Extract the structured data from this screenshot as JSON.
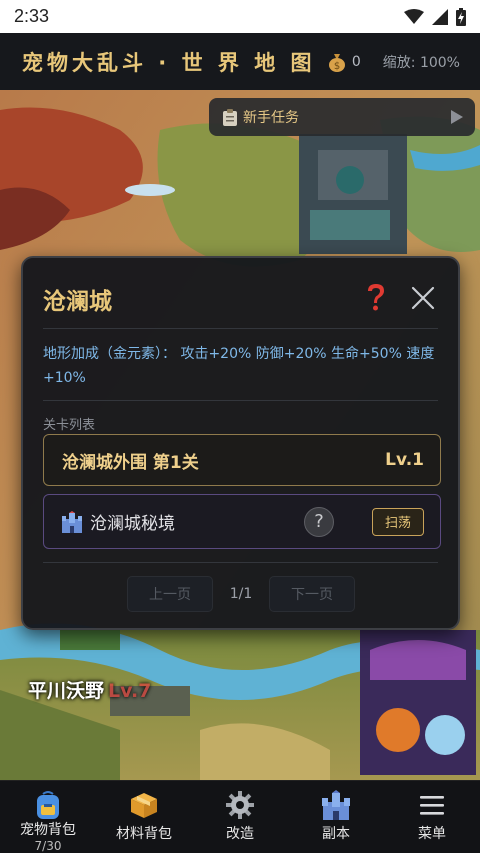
{
  "status_bar": {
    "time": "2:33",
    "icons": [
      "wifi-icon",
      "signal-icon",
      "battery-charging-icon"
    ]
  },
  "header": {
    "title": "宠物大乱斗 · 世 界 地 图",
    "gold_icon": "money-bag-icon",
    "gold_value": "0",
    "zoom_text": "缩放: 100%"
  },
  "quest_bar": {
    "icon": "clipboard-icon",
    "label": "新手任务",
    "arrow_icon": "play-triangle-icon"
  },
  "map": {
    "region_name": "平川沃野",
    "region_level": "Lv.7"
  },
  "dialog": {
    "title": "沧澜城",
    "help_icon": "question-mark-icon",
    "close_icon": "close-icon",
    "terrain_bonus": "地形加成（金元素）： 攻击+20% 防御+20% 生命+50% 速度+10%",
    "section_label": "关卡列表",
    "stages": [
      {
        "name": "沧澜城外围 第1关",
        "level": "Lv.1"
      }
    ],
    "secret_realm": {
      "icon": "castle-icon",
      "name": "沧澜城秘境",
      "help_symbol": "?",
      "sweep_label": "扫荡"
    },
    "pager": {
      "prev_label": "上一页",
      "page_text": "1/1",
      "next_label": "下一页"
    }
  },
  "bottom_nav": [
    {
      "label": "宠物背包",
      "count": "7/30",
      "icon": "backpack-icon"
    },
    {
      "label": "材料背包",
      "icon": "package-icon"
    },
    {
      "label": "改造",
      "icon": "gear-icon"
    },
    {
      "label": "副本",
      "icon": "castle-icon"
    },
    {
      "label": "菜单",
      "icon": "hamburger-menu-icon"
    }
  ],
  "colors": {
    "gold_accent": "#e8c77a",
    "bonus_blue": "#7fb8e8",
    "nav_bg": "#121316",
    "dialog_bg": "#15171c"
  }
}
